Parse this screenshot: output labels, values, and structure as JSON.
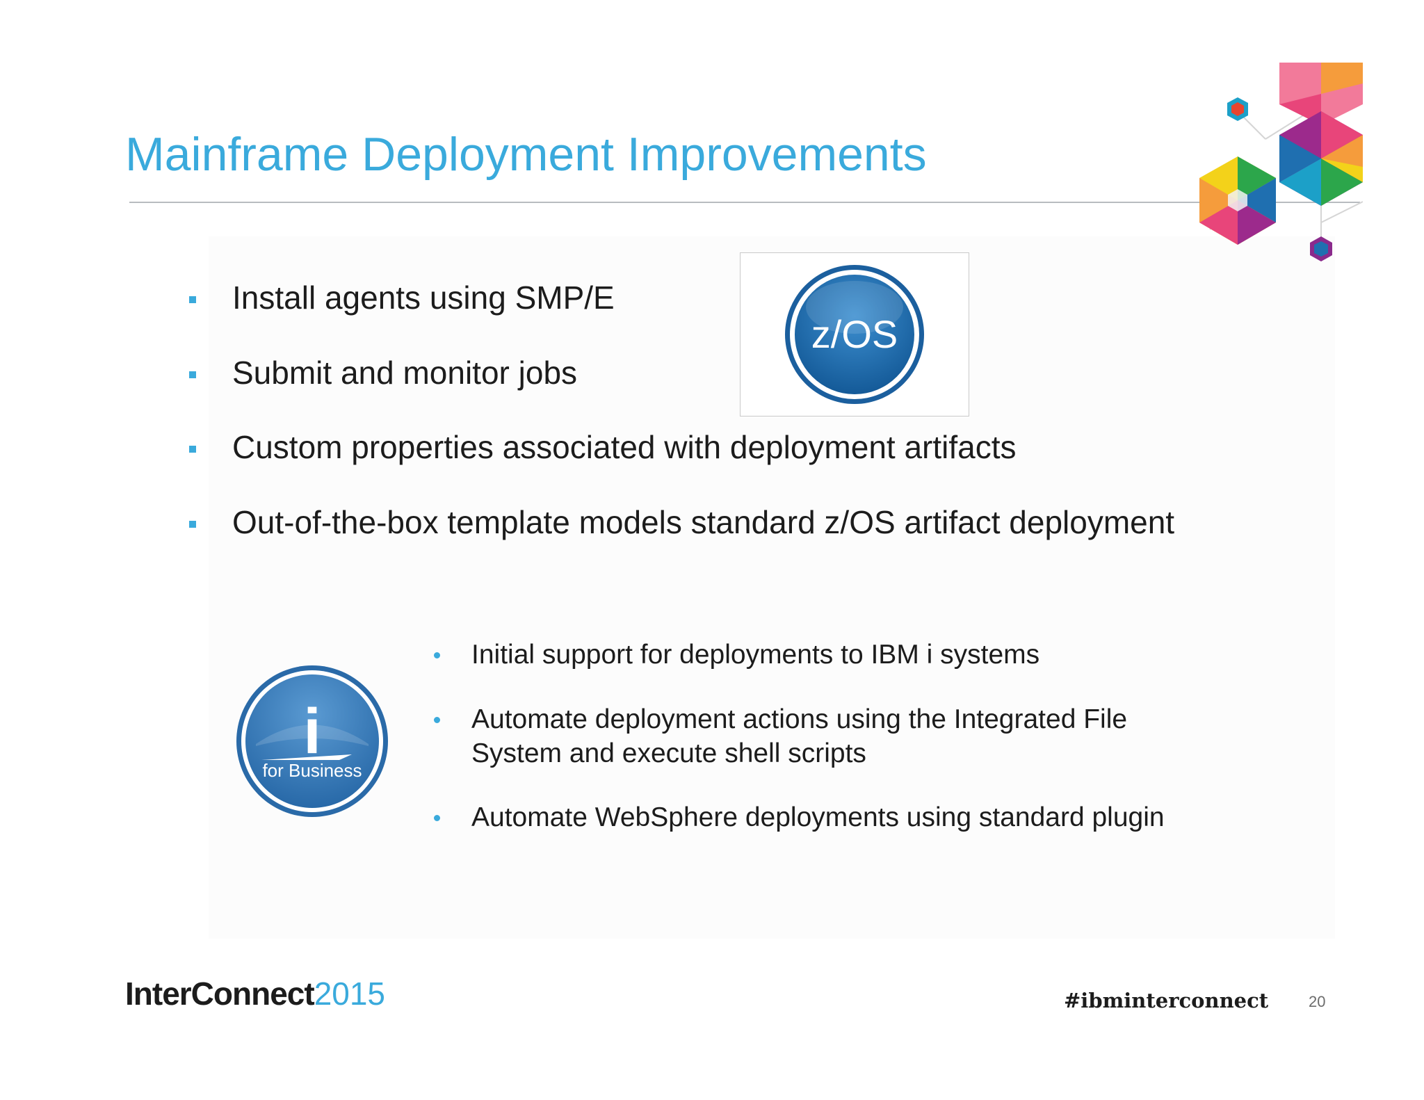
{
  "slide": {
    "title": "Mainframe Deployment Improvements",
    "top_bullets": [
      "Install agents using SMP/E",
      "Submit and monitor jobs",
      "Custom properties associated with deployment artifacts",
      "Out-of-the-box template models standard z/OS artifact deployment"
    ],
    "bottom_bullets": [
      "Initial support for deployments to IBM i systems",
      "Automate deployment actions using the Integrated File",
      "System and execute shell scripts",
      "Automate WebSphere deployments using standard plugin"
    ],
    "zos_logo_text": "z/OS",
    "ibmi_logo_letter": "i",
    "ibmi_logo_caption": "for Business"
  },
  "footer": {
    "brand": "InterConnect",
    "year": "2015",
    "hashtag": "#ibminterconnect",
    "page_number": "20"
  },
  "colors": {
    "accent": "#3aaadc",
    "text": "#1c1c1c",
    "logo_blue": "#1f6fb0"
  },
  "icons": [
    "decorative-hexagon-cluster",
    "zos-logo",
    "ibm-i-for-business-logo"
  ]
}
